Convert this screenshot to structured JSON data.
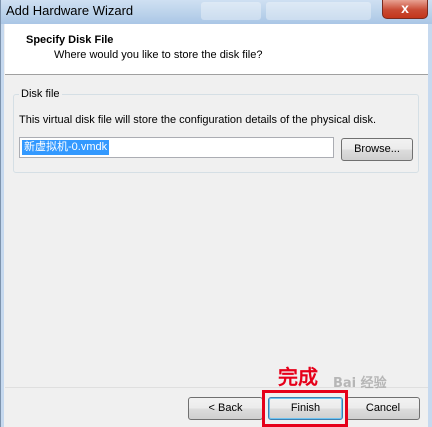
{
  "window": {
    "title": "Add Hardware Wizard",
    "close_glyph": "x"
  },
  "header": {
    "title": "Specify Disk File",
    "subtitle": "Where would you like to store the disk file?"
  },
  "disk_file_group": {
    "legend": "Disk file",
    "description": "This virtual disk file will store the configuration details of the physical disk.",
    "file_path_value": "新虚拟机-0.vmdk",
    "browse_label": "Browse..."
  },
  "footer": {
    "back_label": "< Back",
    "finish_label": "Finish",
    "cancel_label": "Cancel"
  },
  "annotation": {
    "text": "完成",
    "color": "#e6001a"
  },
  "watermark": {
    "text": "Bai 经验"
  }
}
